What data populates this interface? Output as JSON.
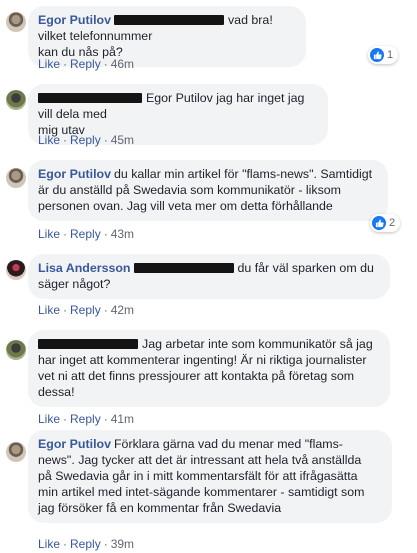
{
  "comments": [
    {
      "name": "Egor Putilov",
      "text_lines": [
        "vad bra! vilket telefonnummer",
        "kan du nås på?"
      ],
      "actions": {
        "like": "Like",
        "reply": "Reply",
        "time": "46m"
      },
      "reactions": "1"
    },
    {
      "name": "",
      "text_lines": [
        "Egor Putilov jag har inget jag vill dela med",
        "mig utav"
      ],
      "actions": {
        "like": "Like",
        "reply": "Reply",
        "time": "45m"
      }
    },
    {
      "name": "Egor Putilov",
      "text_lines": [
        "du kallar min artikel för \"flams-news\". Samtidigt",
        "är du anställd på Swedavia som kommunikatör - liksom",
        "personen ovan. Jag vill veta mer om detta förhållande"
      ],
      "actions": {
        "like": "Like",
        "reply": "Reply",
        "time": "43m"
      },
      "reactions": "2"
    },
    {
      "name": "Lisa Andersson",
      "text_lines": [
        "du får väl sparken om du",
        "säger något?"
      ],
      "actions": {
        "like": "Like",
        "reply": "Reply",
        "time": "42m"
      }
    },
    {
      "name": "",
      "text_lines": [
        "Jag arbetar inte som kommunikatör så jag",
        "har inget att kommenterar ingenting! Är ni riktiga journalister",
        "vet ni att det finns pressjourer att kontakta på företag som",
        "dessa!"
      ],
      "actions": {
        "like": "Like",
        "reply": "Reply",
        "time": "41m"
      }
    },
    {
      "name": "Egor Putilov",
      "text_lines": [
        "Förklara gärna vad du menar med \"flams-",
        "news\". Jag tycker att det är intressant att hela två anställda",
        "på Swedavia går in i mitt kommentarsfält för att ifrågasätta",
        "min artikel med intet-sägande kommentarer - samtidigt som",
        "jag försöker få en kommentar från Swedavia"
      ],
      "actions": {
        "like": "Like",
        "reply": "Reply",
        "time": "39m"
      }
    }
  ],
  "colors": {
    "name": "#385898",
    "bubble": "#f2f3f5",
    "meta": "#606770",
    "reaction": "#1877f2"
  }
}
